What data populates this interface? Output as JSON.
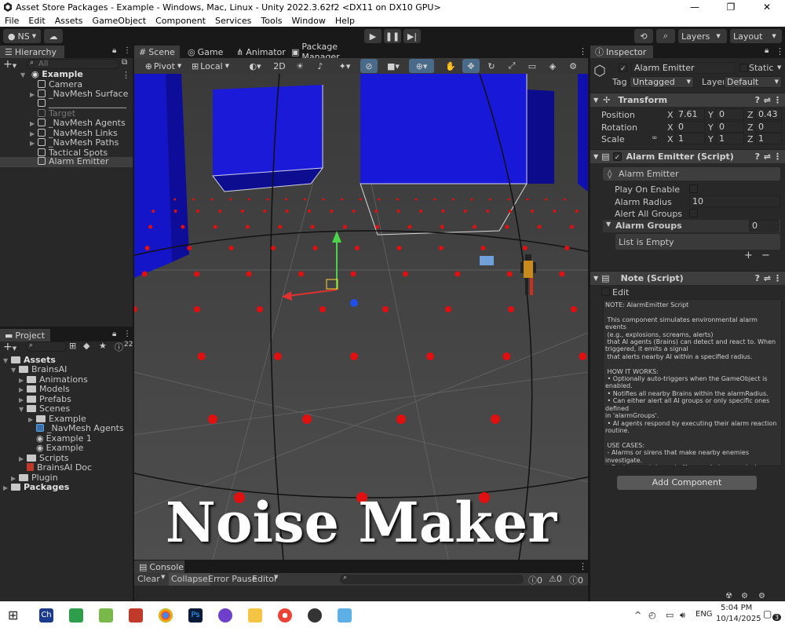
{
  "window": {
    "title": "Asset Store Packages - Example - Windows, Mac, Linux - Unity 2022.3.62f2 <DX11 on DX10 GPU>",
    "minimize": "—",
    "maximize": "❐",
    "close": "✕"
  },
  "menu": [
    "File",
    "Edit",
    "Assets",
    "GameObject",
    "Component",
    "Services",
    "Tools",
    "Window",
    "Help"
  ],
  "toolbar": {
    "account": "NS",
    "layers": "Layers",
    "layout": "Layout"
  },
  "hierarchy": {
    "tab": "Hierarchy",
    "search_placeholder": "All",
    "items": [
      {
        "label": "Example"
      },
      {
        "label": "Camera"
      },
      {
        "label": "_NavMesh Surface"
      },
      {
        "label": "__________________"
      },
      {
        "label": "Target"
      },
      {
        "label": "_NavMesh Agents"
      },
      {
        "label": "_NavMesh Links"
      },
      {
        "label": "_NavMesh Paths"
      },
      {
        "label": "Tactical Spots"
      },
      {
        "label": "Alarm Emitter"
      }
    ]
  },
  "project": {
    "tab": "Project",
    "items": [
      {
        "label": "Assets"
      },
      {
        "label": "BrainsAI"
      },
      {
        "label": "Animations"
      },
      {
        "label": "Models"
      },
      {
        "label": "Prefabs"
      },
      {
        "label": "Scenes"
      },
      {
        "label": "Example"
      },
      {
        "label": "_NavMesh Agents"
      },
      {
        "label": "Example 1"
      },
      {
        "label": "Example"
      },
      {
        "label": "Scripts"
      },
      {
        "label": "BrainsAI Doc"
      },
      {
        "label": "Plugin"
      },
      {
        "label": "Packages"
      }
    ],
    "count": "22"
  },
  "scene": {
    "tabs": [
      "Scene",
      "Game",
      "Animator",
      "Package Manager"
    ],
    "pivot": "Pivot",
    "local": "Local",
    "mode2d": "2D",
    "overlay_title": "Noise Maker"
  },
  "console": {
    "tab": "Console",
    "clear": "Clear",
    "collapse": "Collapse",
    "error_pause": "Error Pause",
    "editor": "Editor",
    "counts": [
      "0",
      "0",
      "0"
    ]
  },
  "inspector": {
    "tab": "Inspector",
    "object_name": "Alarm Emitter",
    "static_label": "Static",
    "tag_label": "Tag",
    "tag_value": "Untagged",
    "layer_label": "Layer",
    "layer_value": "Default",
    "transform": {
      "title": "Transform",
      "position_label": "Position",
      "rotation_label": "Rotation",
      "scale_label": "Scale",
      "position": [
        "7.61",
        "0",
        "0.43"
      ],
      "rotation": [
        "0",
        "0",
        "0"
      ],
      "scale": [
        "1",
        "1",
        "1"
      ]
    },
    "alarm_script": {
      "title": "Alarm Emitter (Script)",
      "subtitle": "Alarm Emitter",
      "play_on_enable": "Play On Enable",
      "alarm_radius_label": "Alarm Radius",
      "alarm_radius": "10",
      "alert_all_groups": "Alert All Groups",
      "alarm_groups": "Alarm Groups",
      "alarm_groups_count": "0",
      "list_empty": "List is Empty"
    },
    "note_script": {
      "title": "Note (Script)",
      "edit": "Edit",
      "text": "NOTE: AlarmEmitter Script\n\n This component simulates environmental alarm events\n (e.g., explosions, screams, alerts)\n that AI agents (Brains) can detect and react to. When\ntriggered, it emits a signal\n that alerts nearby AI within a specified radius.\n\n HOW IT WORKS:\n • Optionally auto-triggers when the GameObject is\nenabled.\n • Notifies all nearby Brains within the alarmRadius.\n • Can either alert all AI groups or only specific ones defined\nin 'alarmGroups'.\n • AI agents respond by executing their alarm reaction\nroutine.\n\n USE CASES:\n - Alarms or sirens that make nearby enemies investigate.\n - Environmental events like gunshots or explosions.\n - Traps or scripted sequences to alert specific groups of\nNPCs."
    },
    "add_component": "Add Component"
  },
  "taskbar": {
    "language": "ENG",
    "time": "5:04 PM",
    "date": "10/14/2025",
    "notif": "3"
  }
}
